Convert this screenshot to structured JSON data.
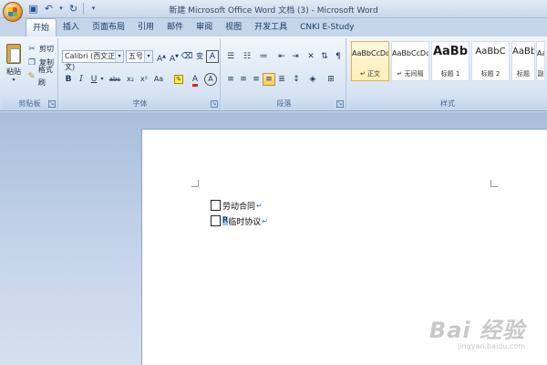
{
  "window": {
    "title": "新建 Microsoft Office Word 文档 (3) - Microsoft Word"
  },
  "tabs": [
    "开始",
    "插入",
    "页面布局",
    "引用",
    "邮件",
    "审阅",
    "视图",
    "开发工具",
    "CNKI E-Study"
  ],
  "clipboard": {
    "paste_label": "粘贴",
    "cut_label": "剪切",
    "copy_label": "复制",
    "format_painter_label": "格式刷",
    "group_label": "剪贴板"
  },
  "font": {
    "font_name": "Calibri (西文正文)",
    "font_size": "五号",
    "group_label": "字体",
    "phonetic_glyph": "变",
    "char_border_glyph": "A",
    "bold": "B",
    "italic": "I",
    "underline": "U",
    "strike": "abc",
    "subscript": "x₂",
    "superscript": "x²",
    "change_case": "Aa",
    "font_color_glyph": "A",
    "char_shading_glyph": "A"
  },
  "paragraph": {
    "group_label": "段落"
  },
  "styles": {
    "group_label": "样式",
    "items": [
      {
        "preview": "AaBbCcDd",
        "name": "↵ 正文"
      },
      {
        "preview": "AaBbCcDd",
        "name": "↵ 无间隔"
      },
      {
        "preview": "AaBb",
        "name": "标题 1"
      },
      {
        "preview": "AaBbC",
        "name": "标题 2"
      },
      {
        "preview": "AaBbC",
        "name": "标题"
      },
      {
        "preview": "Aa",
        "name": "副"
      }
    ]
  },
  "document": {
    "lines": [
      {
        "text": "劳动合同",
        "mark": "↵"
      },
      {
        "selected": "R",
        "text": "临时协议",
        "mark": "↵"
      }
    ]
  },
  "watermark": {
    "brand": "Bai 经验",
    "url": "jingyan.baidu.com"
  }
}
